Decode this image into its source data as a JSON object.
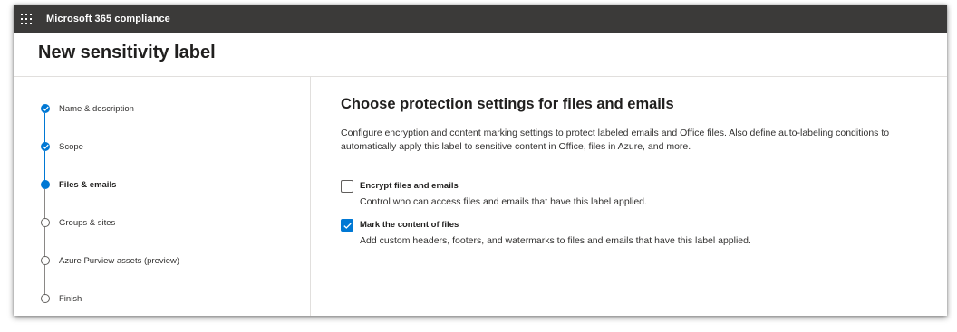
{
  "app": {
    "name": "Microsoft 365 compliance",
    "launcher_icon": "app-launcher-waffle-icon"
  },
  "page": {
    "title": "New sensitivity label"
  },
  "wizard": {
    "steps": [
      {
        "label": "Name & description",
        "state": "completed",
        "icon": "check-circle-icon"
      },
      {
        "label": "Scope",
        "state": "completed",
        "icon": "check-circle-icon"
      },
      {
        "label": "Files & emails",
        "state": "current",
        "icon": "filled-circle-icon"
      },
      {
        "label": "Groups & sites",
        "state": "pending",
        "icon": "empty-circle-icon"
      },
      {
        "label": "Azure Purview assets (preview)",
        "state": "pending",
        "icon": "empty-circle-icon"
      },
      {
        "label": "Finish",
        "state": "pending",
        "icon": "empty-circle-icon"
      }
    ]
  },
  "main": {
    "title": "Choose protection settings for files and emails",
    "description": "Configure encryption and content marking settings to protect labeled emails and Office files. Also define auto-labeling conditions to automatically apply this label to sensitive content in Office, files in Azure, and more.",
    "options": [
      {
        "label": "Encrypt files and emails",
        "description": "Control who can access files and emails that have this label applied.",
        "checked": false
      },
      {
        "label": "Mark the content of files",
        "description": "Add custom headers, footers, and watermarks to files and emails that have this label applied.",
        "checked": true
      }
    ]
  },
  "colors": {
    "accent": "#0078d4",
    "topbar": "#3b3a39",
    "text": "#323130"
  }
}
